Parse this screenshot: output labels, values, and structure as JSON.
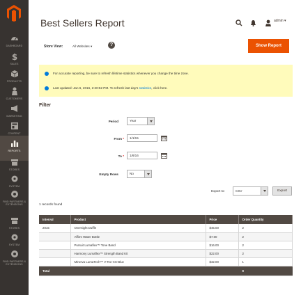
{
  "sidebar": {
    "items": [
      {
        "label": "DASHBOARD",
        "icon": "dashboard-icon"
      },
      {
        "label": "SALES",
        "icon": "dollar-icon"
      },
      {
        "label": "PRODUCTS",
        "icon": "cube-icon"
      },
      {
        "label": "CUSTOMERS",
        "icon": "person-icon"
      },
      {
        "label": "MARKETING",
        "icon": "megaphone-icon"
      },
      {
        "label": "CONTENT",
        "icon": "layout-icon"
      },
      {
        "label": "REPORTS",
        "icon": "bar-chart-icon"
      },
      {
        "label": "STORES",
        "icon": "store-icon"
      },
      {
        "label": "SYSTEM",
        "icon": "gear-icon"
      },
      {
        "label": "FIND PARTNERS & EXTENSIONS",
        "icon": "partners-icon"
      },
      {
        "label": "STORES",
        "icon": "store-icon"
      },
      {
        "label": "SYSTEM",
        "icon": "gear-icon"
      },
      {
        "label": "FIND PARTNERS & EXTENSIONS",
        "icon": "partners-icon"
      }
    ]
  },
  "header": {
    "title": "Best Sellers Report",
    "user": "admin"
  },
  "store_view": {
    "label": "Store View:",
    "value": "All Websites"
  },
  "actions": {
    "show_report": "Show Report"
  },
  "messages": [
    {
      "text": "For accurate reporting, be sure to refresh lifetime statistics whenever you change the time zone.",
      "link": ""
    },
    {
      "text": "Last updated: Jan 6, 2016, 2:20:52 PM. To refresh last day's",
      "link": "statistics",
      "tail": ", click here."
    }
  ],
  "filter": {
    "title": "Filter",
    "period_label": "Period",
    "period_value": "Year",
    "from_label": "From",
    "from_value": "1/1/15",
    "to_label": "To",
    "to_value": "1/6/16",
    "empty_rows_label": "Empty Rows",
    "empty_rows_value": "No"
  },
  "export": {
    "label": "Export to:",
    "format": "CSV",
    "button": "Export"
  },
  "records_found": "1 records found",
  "table": {
    "headers": [
      "Interval",
      "Product",
      "Price",
      "Order Quantity"
    ],
    "rows": [
      {
        "interval": "2015",
        "product": "Overnight Duffle",
        "price": "$45.00",
        "qty": "2"
      },
      {
        "interval": "",
        "product": "Affirm Water Bottle",
        "price": "$7.00",
        "qty": "2"
      },
      {
        "interval": "",
        "product": "Pursuit Lumaflex™ Tone Band",
        "price": "$16.00",
        "qty": "2"
      },
      {
        "interval": "",
        "product": "Harmony Lumaflex™ Strength Band Kit",
        "price": "$22.00",
        "qty": "2"
      },
      {
        "interval": "",
        "product": "Minerva LumaTech™ V-Tee-XS-Blue",
        "price": "$32.00",
        "qty": "1"
      }
    ],
    "total_label": "Total",
    "total_qty": "9"
  },
  "colors": {
    "sidebar": "#373330",
    "accent": "#eb5202",
    "message_bg": "#fffbbb",
    "table_header": "#514943",
    "link": "#007bdb"
  }
}
